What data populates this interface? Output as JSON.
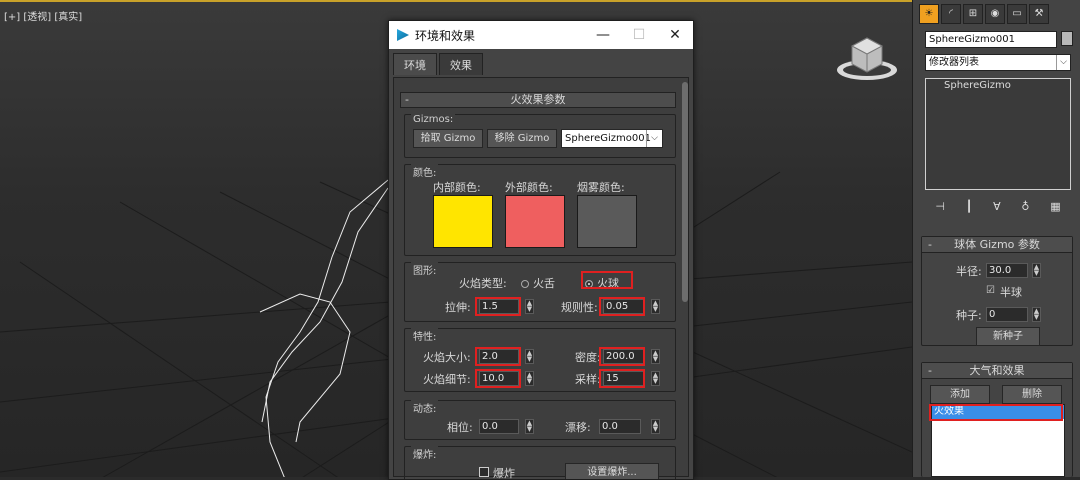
{
  "viewport": {
    "label": "[+] [透视] [真实]"
  },
  "dialog": {
    "title": "环境和效果",
    "minimize": "—",
    "maximize": "☐",
    "close": "✕",
    "tabs": [
      "环境",
      "效果"
    ],
    "rollout_title": "火效果参数",
    "rollout_minus": "-",
    "gizmos": {
      "group_label": "Gizmos:",
      "pick_button": "拾取 Gizmo",
      "remove_button": "移除 Gizmo",
      "selected_gizmo": "SphereGizmo001"
    },
    "colors": {
      "group_label": "颜色:",
      "inner_label": "内部颜色:",
      "outer_label": "外部颜色:",
      "smoke_label": "烟雾颜色:",
      "inner_color": "#ffe500",
      "outer_color": "#ef5f5f",
      "smoke_color": "#5a5a5a"
    },
    "shape": {
      "group_label": "图形:",
      "flame_type_label": "火焰类型:",
      "option_tongue": "火舌",
      "option_fireball": "火球",
      "stretch_label": "拉伸:",
      "stretch_value": "1.5",
      "regularity_label": "规则性:",
      "regularity_value": "0.05"
    },
    "characteristics": {
      "group_label": "特性:",
      "flame_size_label": "火焰大小:",
      "flame_size_value": "2.0",
      "density_label": "密度:",
      "density_value": "200.0",
      "flame_detail_label": "火焰细节:",
      "flame_detail_value": "10.0",
      "samples_label": "采样:",
      "samples_value": "15"
    },
    "motion": {
      "group_label": "动态:",
      "phase_label": "相位:",
      "phase_value": "0.0",
      "drift_label": "漂移:",
      "drift_value": "0.0"
    },
    "explosion": {
      "group_label": "爆炸:",
      "explode_checkbox_label": "爆炸",
      "setup_button": "设置爆炸..."
    }
  },
  "command_panel": {
    "tab_icons": [
      "sun-icon",
      "curve-icon",
      "hierarchy-icon",
      "motion-icon",
      "display-icon",
      "utilities-icon"
    ],
    "object_name": "SphereGizmo001",
    "modifier_list": "修改器列表",
    "stack_items": [
      "SphereGizmo"
    ],
    "sphere_rollout": {
      "title": "球体 Gizmo 参数",
      "radius_label": "半径:",
      "radius_value": "30.0",
      "hemisphere_label": "半球",
      "seed_label": "种子:",
      "seed_value": "0",
      "new_seed_button": "新种子"
    },
    "atmos_rollout": {
      "title": "大气和效果",
      "add_button": "添加",
      "delete_button": "删除",
      "items": [
        "火效果"
      ]
    }
  },
  "accent": {
    "highlight_red": "#e02020",
    "selection_blue": "#3a8ee8",
    "active_tab_orange": "#f0a020"
  }
}
